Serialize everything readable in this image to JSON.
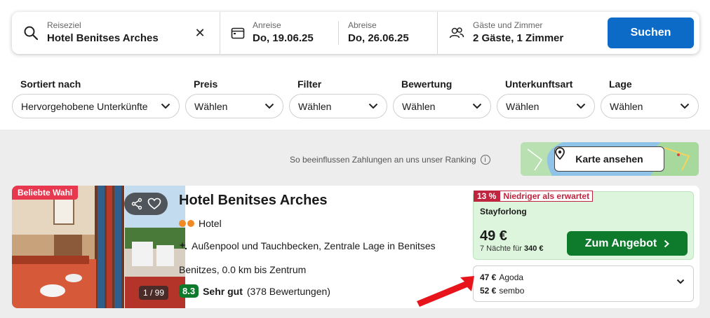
{
  "search": {
    "destination_label": "Reiseziel",
    "destination_value": "Hotel Benitses Arches",
    "clear_icon": "close-icon",
    "checkin_label": "Anreise",
    "checkin_value": "Do, 19.06.25",
    "checkout_label": "Abreise",
    "checkout_value": "Do, 26.06.25",
    "guests_label": "Gäste und Zimmer",
    "guests_value": "2 Gäste, 1 Zimmer",
    "search_button": "Suchen"
  },
  "filters": [
    {
      "label": "Sortiert nach",
      "value": "Hervorgehobene Unterkünfte"
    },
    {
      "label": "Preis",
      "value": "Wählen"
    },
    {
      "label": "Filter",
      "value": "Wählen"
    },
    {
      "label": "Bewertung",
      "value": "Wählen"
    },
    {
      "label": "Unterkunftsart",
      "value": "Wählen"
    },
    {
      "label": "Lage",
      "value": "Wählen"
    }
  ],
  "results": {
    "ranking_note": "So beeinflussen Zahlungen an uns unser Ranking",
    "map_button": "Karte ansehen"
  },
  "hotel": {
    "badge": "Beliebte Wahl",
    "photo_count": "1 / 99",
    "name": "Hotel Benitses Arches",
    "type": "Hotel",
    "amenities": "Außenpool und Tauchbecken, Zentrale Lage in Benitses",
    "location": "Benitzes, 0.0 km bis Zentrum",
    "score": "8.3",
    "rating_label": "Sehr gut",
    "reviews": "(378 Bewertungen)",
    "deal": {
      "discount": "13 %",
      "discount_label": "Niedriger als erwartet",
      "provider": "Stayforlong",
      "price": "49 €",
      "nights_prefix": "7 Nächte für",
      "nights_total": "340 €",
      "cta": "Zum Angebot"
    },
    "alternatives": [
      {
        "price": "47 €",
        "provider": "Agoda"
      },
      {
        "price": "52 €",
        "provider": "sembo"
      }
    ]
  },
  "colors": {
    "primary_blue": "#0b6bc7",
    "deal_green": "#0d7a2c",
    "deal_bg": "#dcf5dc",
    "badge_red": "#e8384f",
    "arrow_red": "#e8141c"
  }
}
